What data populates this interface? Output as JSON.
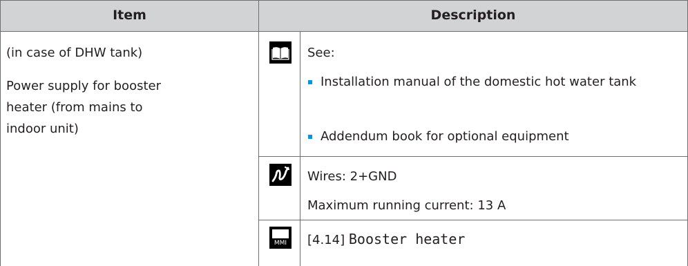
{
  "table": {
    "headers": {
      "item": "Item",
      "description": "Description"
    },
    "row": {
      "item_lines": [
        "(in case of DHW tank)",
        "Power supply for booster heater (from mains to indoor unit)"
      ],
      "see_block": {
        "icon": "book-icon",
        "label": "See:",
        "bullets": [
          "Installation manual of the domestic hot water tank",
          "Addendum book for optional equipment"
        ]
      },
      "wires_block": {
        "icon": "wire-icon",
        "wires": "Wires: 2+GND",
        "current": "Maximum running current: 13 A"
      },
      "mmi_block": {
        "icon": "mmi-icon",
        "icon_text": "MMI",
        "ref": "[4.14]",
        "setting": "Booster heater"
      }
    }
  },
  "colors": {
    "header_bg": "#d1d3d4",
    "border": "#6d6e71",
    "bullet": "#0097e0",
    "text": "#231f20"
  }
}
